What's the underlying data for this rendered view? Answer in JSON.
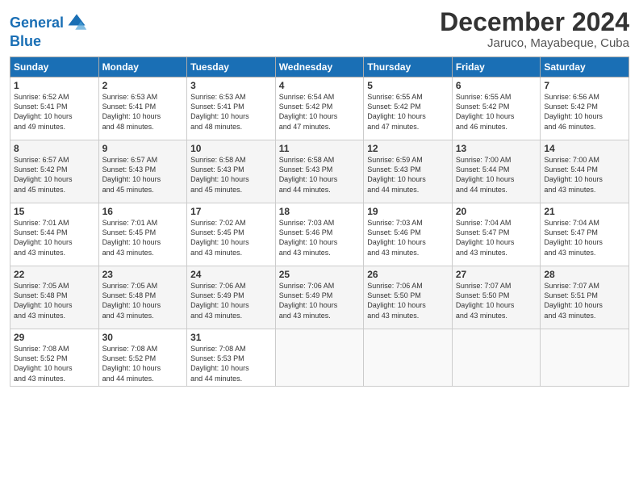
{
  "header": {
    "logo_line1": "General",
    "logo_line2": "Blue",
    "title": "December 2024",
    "subtitle": "Jaruco, Mayabeque, Cuba"
  },
  "columns": [
    "Sunday",
    "Monday",
    "Tuesday",
    "Wednesday",
    "Thursday",
    "Friday",
    "Saturday"
  ],
  "weeks": [
    [
      {
        "day": "1",
        "sunrise": "6:52 AM",
        "sunset": "5:41 PM",
        "daylight": "10 hours and 49 minutes."
      },
      {
        "day": "2",
        "sunrise": "6:53 AM",
        "sunset": "5:41 PM",
        "daylight": "10 hours and 48 minutes."
      },
      {
        "day": "3",
        "sunrise": "6:53 AM",
        "sunset": "5:41 PM",
        "daylight": "10 hours and 48 minutes."
      },
      {
        "day": "4",
        "sunrise": "6:54 AM",
        "sunset": "5:42 PM",
        "daylight": "10 hours and 47 minutes."
      },
      {
        "day": "5",
        "sunrise": "6:55 AM",
        "sunset": "5:42 PM",
        "daylight": "10 hours and 47 minutes."
      },
      {
        "day": "6",
        "sunrise": "6:55 AM",
        "sunset": "5:42 PM",
        "daylight": "10 hours and 46 minutes."
      },
      {
        "day": "7",
        "sunrise": "6:56 AM",
        "sunset": "5:42 PM",
        "daylight": "10 hours and 46 minutes."
      }
    ],
    [
      {
        "day": "8",
        "sunrise": "6:57 AM",
        "sunset": "5:42 PM",
        "daylight": "10 hours and 45 minutes."
      },
      {
        "day": "9",
        "sunrise": "6:57 AM",
        "sunset": "5:43 PM",
        "daylight": "10 hours and 45 minutes."
      },
      {
        "day": "10",
        "sunrise": "6:58 AM",
        "sunset": "5:43 PM",
        "daylight": "10 hours and 45 minutes."
      },
      {
        "day": "11",
        "sunrise": "6:58 AM",
        "sunset": "5:43 PM",
        "daylight": "10 hours and 44 minutes."
      },
      {
        "day": "12",
        "sunrise": "6:59 AM",
        "sunset": "5:43 PM",
        "daylight": "10 hours and 44 minutes."
      },
      {
        "day": "13",
        "sunrise": "7:00 AM",
        "sunset": "5:44 PM",
        "daylight": "10 hours and 44 minutes."
      },
      {
        "day": "14",
        "sunrise": "7:00 AM",
        "sunset": "5:44 PM",
        "daylight": "10 hours and 43 minutes."
      }
    ],
    [
      {
        "day": "15",
        "sunrise": "7:01 AM",
        "sunset": "5:44 PM",
        "daylight": "10 hours and 43 minutes."
      },
      {
        "day": "16",
        "sunrise": "7:01 AM",
        "sunset": "5:45 PM",
        "daylight": "10 hours and 43 minutes."
      },
      {
        "day": "17",
        "sunrise": "7:02 AM",
        "sunset": "5:45 PM",
        "daylight": "10 hours and 43 minutes."
      },
      {
        "day": "18",
        "sunrise": "7:03 AM",
        "sunset": "5:46 PM",
        "daylight": "10 hours and 43 minutes."
      },
      {
        "day": "19",
        "sunrise": "7:03 AM",
        "sunset": "5:46 PM",
        "daylight": "10 hours and 43 minutes."
      },
      {
        "day": "20",
        "sunrise": "7:04 AM",
        "sunset": "5:47 PM",
        "daylight": "10 hours and 43 minutes."
      },
      {
        "day": "21",
        "sunrise": "7:04 AM",
        "sunset": "5:47 PM",
        "daylight": "10 hours and 43 minutes."
      }
    ],
    [
      {
        "day": "22",
        "sunrise": "7:05 AM",
        "sunset": "5:48 PM",
        "daylight": "10 hours and 43 minutes."
      },
      {
        "day": "23",
        "sunrise": "7:05 AM",
        "sunset": "5:48 PM",
        "daylight": "10 hours and 43 minutes."
      },
      {
        "day": "24",
        "sunrise": "7:06 AM",
        "sunset": "5:49 PM",
        "daylight": "10 hours and 43 minutes."
      },
      {
        "day": "25",
        "sunrise": "7:06 AM",
        "sunset": "5:49 PM",
        "daylight": "10 hours and 43 minutes."
      },
      {
        "day": "26",
        "sunrise": "7:06 AM",
        "sunset": "5:50 PM",
        "daylight": "10 hours and 43 minutes."
      },
      {
        "day": "27",
        "sunrise": "7:07 AM",
        "sunset": "5:50 PM",
        "daylight": "10 hours and 43 minutes."
      },
      {
        "day": "28",
        "sunrise": "7:07 AM",
        "sunset": "5:51 PM",
        "daylight": "10 hours and 43 minutes."
      }
    ],
    [
      {
        "day": "29",
        "sunrise": "7:08 AM",
        "sunset": "5:52 PM",
        "daylight": "10 hours and 43 minutes."
      },
      {
        "day": "30",
        "sunrise": "7:08 AM",
        "sunset": "5:52 PM",
        "daylight": "10 hours and 44 minutes."
      },
      {
        "day": "31",
        "sunrise": "7:08 AM",
        "sunset": "5:53 PM",
        "daylight": "10 hours and 44 minutes."
      },
      null,
      null,
      null,
      null
    ]
  ],
  "labels": {
    "sunrise": "Sunrise: ",
    "sunset": "Sunset: ",
    "daylight": "Daylight: "
  }
}
